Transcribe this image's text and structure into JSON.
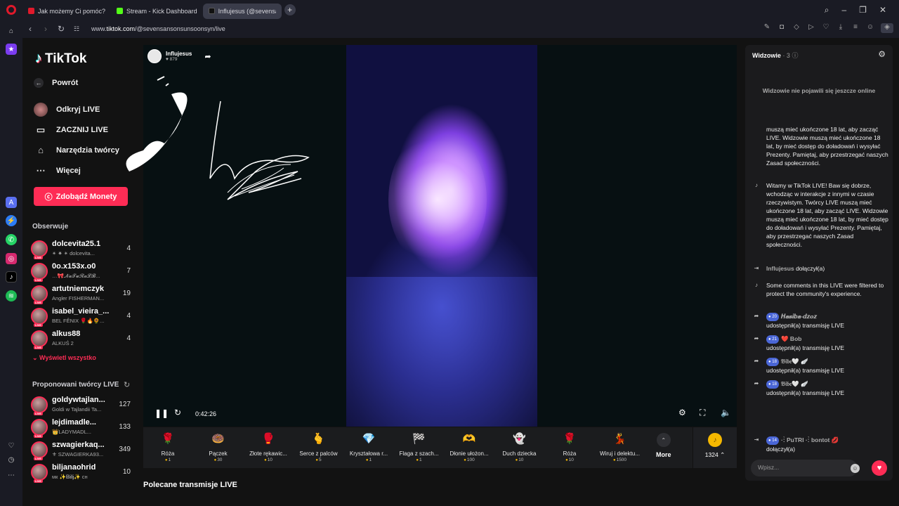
{
  "browser": {
    "tabs": [
      {
        "label": "Jak możemy Ci pomóc?",
        "color": "#e0192b"
      },
      {
        "label": "Stream - Kick Dashboard",
        "color": "#53fc18"
      },
      {
        "label": "Influjesus (@sevensanson",
        "color": "#111111"
      }
    ],
    "url_prefix": "www.",
    "url_domain": "tiktok.com",
    "url_path": "/@sevensansonsunsoonsyn/live"
  },
  "nav": {
    "logo": "TikTok",
    "back": "Powrót",
    "discover": "Odkryj LIVE",
    "start_live": "ZACZNIJ LIVE",
    "creator_tools": "Narzędzia twórcy",
    "more": "Więcej",
    "get_coins": "Zdobądź Monety",
    "following_title": "Obserwuje",
    "following": [
      {
        "name": "dolcevita25.1",
        "sub": "✴ ✷ ✴ dolcevita...",
        "count": "4"
      },
      {
        "name": "0o.x153x.o0",
        "sub": "…🎀𝓝𝓪𝓣𝓾𝓡𝓪𝓛𝓑...",
        "count": "7"
      },
      {
        "name": "artutniemczyk",
        "sub": "Angler FISHERMAN...",
        "count": "19"
      },
      {
        "name": "isabel_vieira_...",
        "sub": "BEL FÊNIX 🌹🔥🌻...",
        "count": "4"
      },
      {
        "name": "alkus88",
        "sub": "ALKUŚ 2",
        "count": "4"
      }
    ],
    "show_all": "Wyświetl wszystko",
    "suggested_title": "Proponowani twórcy LIVE",
    "suggested": [
      {
        "name": "goldywtajlan...",
        "sub": "Goldi w Tajlandii Ta...",
        "count": "127"
      },
      {
        "name": "lejdimadle...",
        "sub": "👑LADYMADL...",
        "count": "133"
      },
      {
        "name": "szwagierkaq...",
        "sub": "⚜ SZWAGIERKA93...",
        "count": "349"
      },
      {
        "name": "biljanaohrid",
        "sub": "мк ✨𝐁𝐢𝐥𝐣✨ сн",
        "count": "10"
      }
    ]
  },
  "player": {
    "host_name": "Influjesus",
    "host_likes": "879",
    "time": "0:42:26"
  },
  "gifts": [
    {
      "name": "Róża",
      "price": "1",
      "icon": "🌹"
    },
    {
      "name": "Pączek",
      "price": "30",
      "icon": "🍩"
    },
    {
      "name": "Złote rękawic...",
      "price": "10",
      "icon": "🥊"
    },
    {
      "name": "Serce z palców",
      "price": "5",
      "icon": "🫰"
    },
    {
      "name": "Kryształowa r...",
      "price": "1",
      "icon": "💎"
    },
    {
      "name": "Flaga z szach...",
      "price": "1",
      "icon": "🏁"
    },
    {
      "name": "Dłonie ułożon...",
      "price": "100",
      "icon": "🫶"
    },
    {
      "name": "Duch dziecka",
      "price": "10",
      "icon": "👻"
    },
    {
      "name": "Róża",
      "price": "10",
      "icon": "🌹"
    },
    {
      "name": "Wiruj i delektu...",
      "price": "1500",
      "icon": "💃"
    }
  ],
  "gift_more": "More",
  "coins": "1324",
  "recommended_title": "Polecane transmisje LIVE",
  "chat": {
    "viewers_label": "Widzowie",
    "viewers_count": "· 3",
    "no_viewers": "Widzowie nie pojawili się jeszcze online",
    "rules_partial": "muszą mieć ukończone 18 lat, aby zacząć LIVE. Widzowie muszą mieć ukończone 18 lat, by mieć dostęp do doładowań i wysyłać Prezenty. Pamiętaj, aby przestrzegać naszych Zasad społeczności.",
    "welcome": "Witamy w TikTok LIVE! Baw się dobrze, wchodząc w interakcje z innymi w czasie rzeczywistym. Twórcy LIVE muszą mieć ukończone 18 lat, aby zacząć LIVE. Widzowie muszą mieć ukończone 18 lat, by mieć dostęp do doładowań i wysyłać Prezenty. Pamiętaj, aby przestrzegać naszych Zasad społeczności.",
    "joined_user": "Influjesus",
    "joined_text": "dołączył(a)",
    "filtered": "Some comments in this LIVE were filtered to protect the community's experience.",
    "shares": [
      {
        "level": "20",
        "user": "𝑯𝒂𝒔𝒊𝒃𝒂-𝒅𝒛𝒐𝒛",
        "text": "udostępnił(a) transmisję LIVE"
      },
      {
        "level": "21",
        "user": "❤️ Bob",
        "text": "udostępnił(a) transmisję LIVE"
      },
      {
        "level": "18",
        "user": "𝔅𝔦𝔟𝔢🤍 🪽",
        "text": "udostępnił(a) transmisję LIVE"
      },
      {
        "level": "18",
        "user": "𝔅𝔦𝔟𝔢🤍 🪽",
        "text": "udostępnił(a) transmisję LIVE"
      }
    ],
    "last_level": "14",
    "last_user": "·:̀ PuTRI ·:̀ bontot 💋",
    "last_text": "dołączył(a)",
    "input_placeholder": "Wpisz..."
  }
}
